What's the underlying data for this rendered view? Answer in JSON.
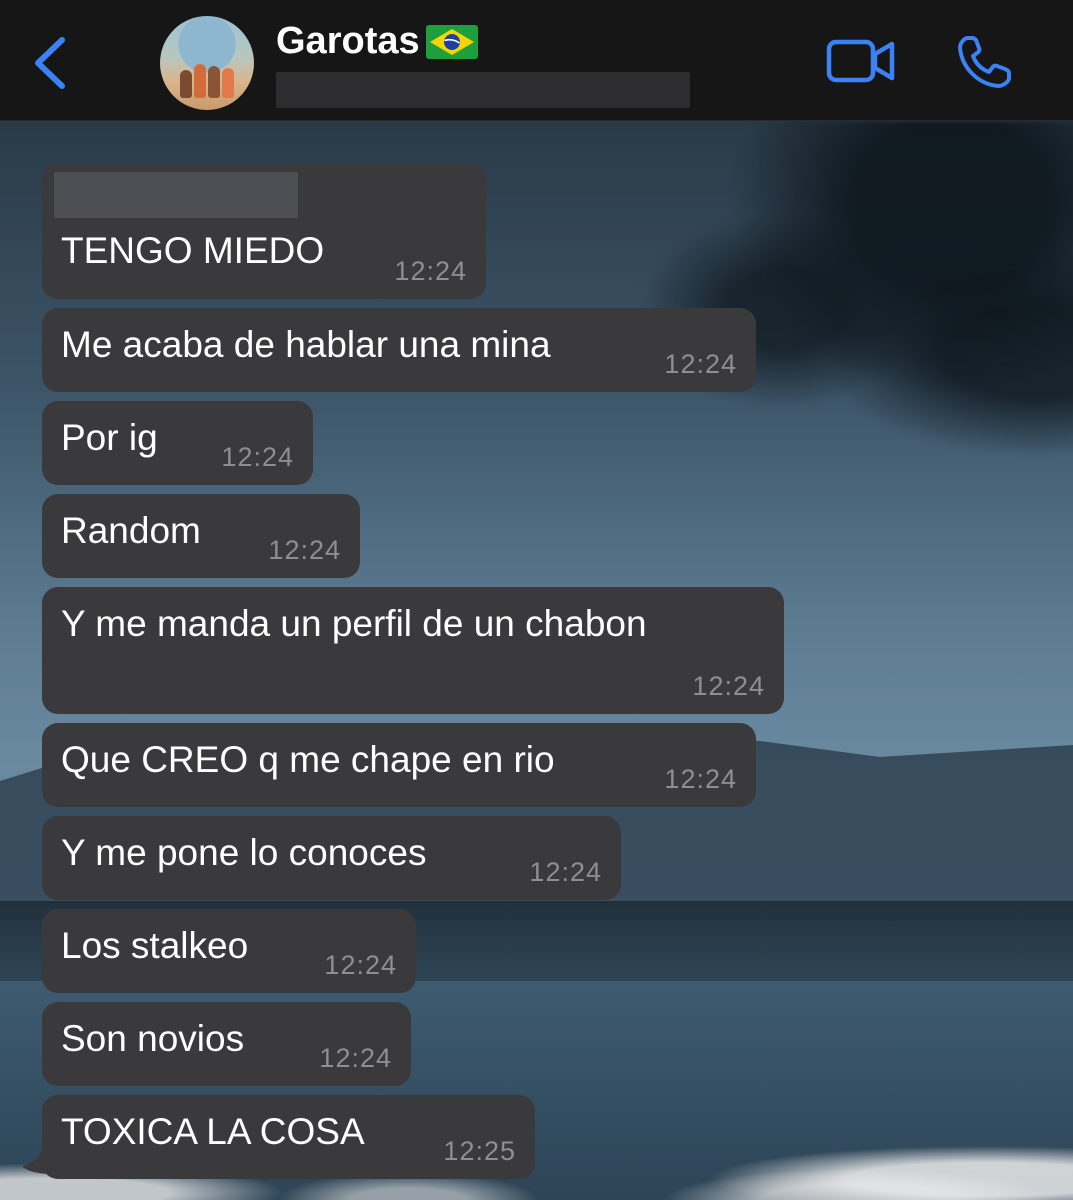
{
  "header": {
    "title": "Garotas",
    "flag_icon": "brazil-flag-icon",
    "accent_color": "#3b82f6",
    "icons": [
      "chevron-left-icon",
      "video-camera-icon",
      "phone-icon"
    ]
  },
  "messages": [
    {
      "text": "TENGO MIEDO",
      "time": "12:24"
    },
    {
      "text": "Me acaba de hablar una mina",
      "time": "12:24"
    },
    {
      "text": "Por ig",
      "time": "12:24"
    },
    {
      "text": "Random",
      "time": "12:24"
    },
    {
      "text": "Y me manda un perfil de un chabon",
      "time": "12:24"
    },
    {
      "text": "Que CREO q me chape en rio",
      "time": "12:24"
    },
    {
      "text": "Y me pone lo conoces",
      "time": "12:24"
    },
    {
      "text": "Los stalkeo",
      "time": "12:24"
    },
    {
      "text": "Son novios",
      "time": "12:24"
    },
    {
      "text": "TOXICA LA COSA",
      "time": "12:25"
    }
  ]
}
